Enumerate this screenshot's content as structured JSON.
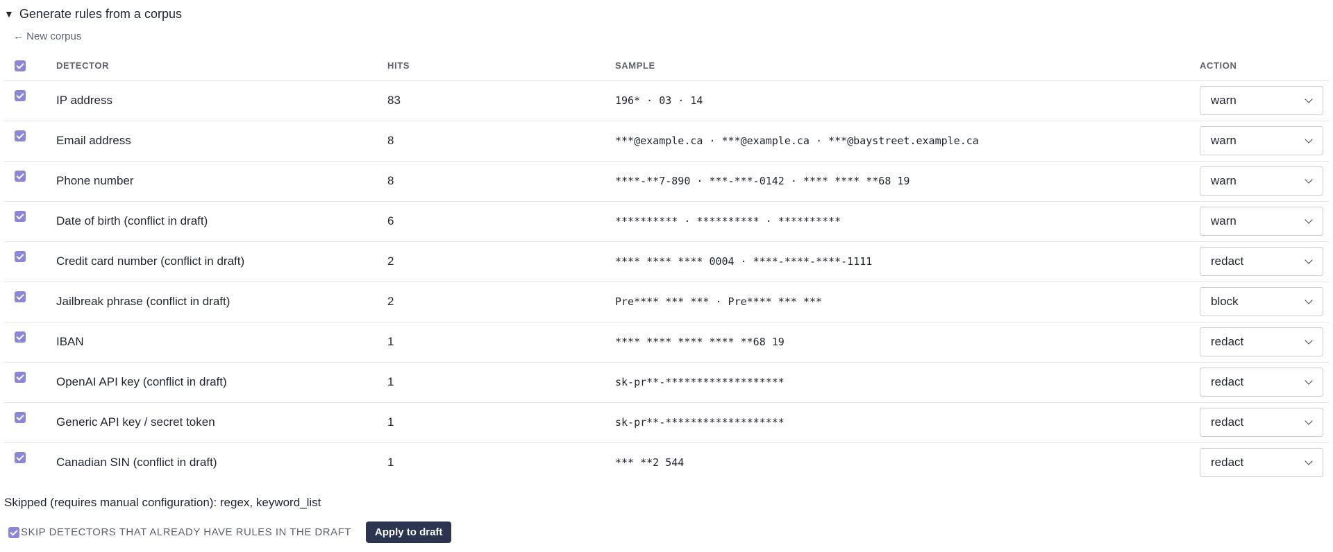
{
  "section": {
    "title": "Generate rules from a corpus",
    "new_corpus_label": "← New corpus"
  },
  "table": {
    "headers": {
      "detector": "DETECTOR",
      "hits": "HITS",
      "sample": "SAMPLE",
      "action": "ACTION"
    },
    "rows": [
      {
        "checked": true,
        "detector": "IP address",
        "hits": "83",
        "sample": "196* · 03 · 14",
        "action": "warn"
      },
      {
        "checked": true,
        "detector": "Email address",
        "hits": "8",
        "sample": "***@example.ca · ***@example.ca · ***@baystreet.example.ca",
        "action": "warn"
      },
      {
        "checked": true,
        "detector": "Phone number",
        "hits": "8",
        "sample": "****-**7-890 · ***-***-0142 · **** **** **68 19",
        "action": "warn"
      },
      {
        "checked": true,
        "detector": "Date of birth  (conflict in draft)",
        "hits": "6",
        "sample": "********** · ********** · **********",
        "action": "warn"
      },
      {
        "checked": true,
        "detector": "Credit card number  (conflict in draft)",
        "hits": "2",
        "sample": "**** **** **** 0004 · ****-****-****-1111",
        "action": "redact"
      },
      {
        "checked": true,
        "detector": "Jailbreak phrase  (conflict in draft)",
        "hits": "2",
        "sample": "Pre**** *** *** · Pre**** *** ***",
        "action": "block"
      },
      {
        "checked": true,
        "detector": "IBAN",
        "hits": "1",
        "sample": "**** **** **** **** **68 19",
        "action": "redact"
      },
      {
        "checked": true,
        "detector": "OpenAI API key  (conflict in draft)",
        "hits": "1",
        "sample": "sk-pr**-*******************",
        "action": "redact"
      },
      {
        "checked": true,
        "detector": "Generic API key / secret token",
        "hits": "1",
        "sample": "sk-pr**-*******************",
        "action": "redact"
      },
      {
        "checked": true,
        "detector": "Canadian SIN  (conflict in draft)",
        "hits": "1",
        "sample": "*** **2 544",
        "action": "redact"
      }
    ]
  },
  "skipped_text": "Skipped (requires manual configuration): regex, keyword_list",
  "footer": {
    "skip_existing_label": "SKIP DETECTORS THAT ALREADY HAVE RULES IN THE DRAFT",
    "apply_label": "Apply to draft"
  },
  "colors": {
    "checkbox": "#8b86d6",
    "apply_button": "#2b3550"
  }
}
